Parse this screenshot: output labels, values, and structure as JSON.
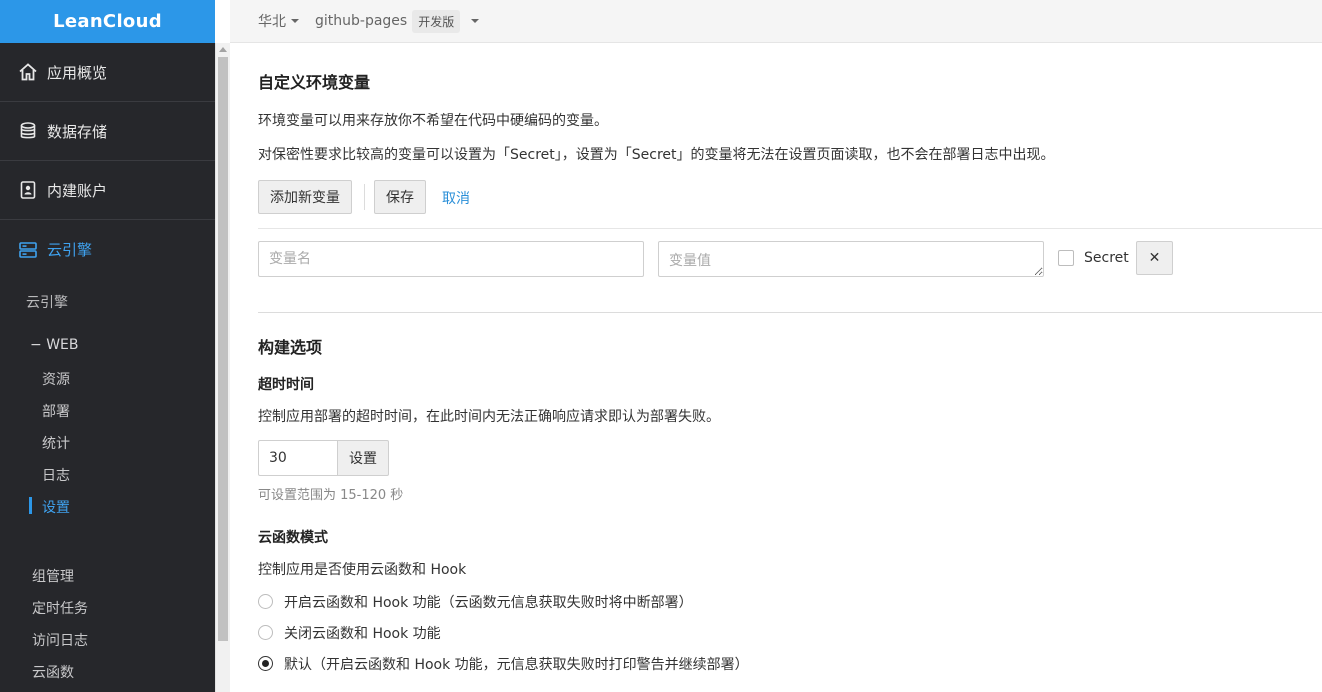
{
  "brand": "LeanCloud",
  "sidebar": {
    "main_items": [
      {
        "label": "应用概览",
        "icon": "home-icon"
      },
      {
        "label": "数据存储",
        "icon": "database-icon"
      },
      {
        "label": "内建账户",
        "icon": "user-card-icon"
      },
      {
        "label": "云引擎",
        "icon": "server-icon",
        "active": true
      }
    ],
    "section_title": "云引擎",
    "web_group": "WEB",
    "web_items": [
      "资源",
      "部署",
      "统计",
      "日志",
      "设置"
    ],
    "web_active": "设置",
    "other_items": [
      "组管理",
      "定时任务",
      "访问日志",
      "云函数"
    ]
  },
  "topbar": {
    "region": "华北",
    "app_name": "github-pages",
    "env_badge": "开发版"
  },
  "env_vars": {
    "title": "自定义环境变量",
    "desc1": "环境变量可以用来存放你不希望在代码中硬编码的变量。",
    "desc2": "对保密性要求比较高的变量可以设置为「Secret」，设置为「Secret」的变量将无法在设置页面读取，也不会在部署日志中出现。",
    "add_button": "添加新变量",
    "save_button": "保存",
    "cancel_link": "取消",
    "name_placeholder": "变量名",
    "value_placeholder": "变量值",
    "secret_label": "Secret",
    "remove_symbol": "✕"
  },
  "build": {
    "title": "构建选项",
    "timeout_title": "超时时间",
    "timeout_desc": "控制应用部署的超时时间，在此时间内无法正确响应请求即认为部署失败。",
    "timeout_value": "30",
    "set_button": "设置",
    "timeout_hint": "可设置范围为 15-120 秒",
    "mode_title": "云函数模式",
    "mode_desc": "控制应用是否使用云函数和 Hook",
    "mode_options": [
      "开启云函数和 Hook 功能（云函数元信息获取失败时将中断部署）",
      "关闭云函数和 Hook 功能",
      "默认（开启云函数和 Hook 功能，元信息获取失败时打印警告并继续部署）"
    ],
    "mode_selected": 2
  },
  "colors": {
    "brand": "#2c97e8",
    "sidebar_bg": "#26272b",
    "accent": "#3fa2ef",
    "link": "#2a8fd8"
  }
}
